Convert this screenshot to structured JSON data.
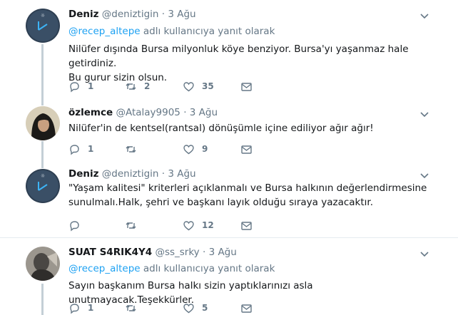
{
  "tweets": [
    {
      "name": "Deniz",
      "handle": "@deniztigin",
      "time": "3 Ağu",
      "reply_mention": "@recep_altepe",
      "reply_suffix": "adlı kullanıcıya yanıt olarak",
      "lines": [
        "Nilüfer dışında Bursa milyonluk köye benziyor. Bursa'yı yaşanmaz hale getirdiniz.",
        "Bu gurur sizin olsun."
      ],
      "replies": "1",
      "retweets": "2",
      "likes": "35"
    },
    {
      "name": "özlemce",
      "handle": "@Atalay9905",
      "time": "3 Ağu",
      "lines": [
        "Nilüfer'in de kentsel(rantsal) dönüşümle içine ediliyor ağır ağır!"
      ],
      "replies": "1",
      "retweets": "",
      "likes": "9"
    },
    {
      "name": "Deniz",
      "handle": "@deniztigin",
      "time": "3 Ağu",
      "lines": [
        "\"Yaşam kalitesi\" kriterleri açıklanmalı ve Bursa halkının değerlendirmesine",
        "sunulmalı.Halk, şehri ve başkanı layık olduğu sıraya yazacaktır."
      ],
      "replies": "",
      "retweets": "",
      "likes": "12"
    },
    {
      "name": "SUAT S4RIK4Y4",
      "handle": "@ss_srky",
      "time": "3 Ağu",
      "reply_mention": "@recep_altepe",
      "reply_suffix": "adlı kullanıcıya yanıt olarak",
      "lines": [
        "Sayın başkanım Bursa halkı sizin yaptıklarınızı asla unutmayacak.Teşekkürler."
      ],
      "replies": "1",
      "retweets": "",
      "likes": "5"
    }
  ],
  "separator": "·",
  "colors": {
    "link": "#1da1f2",
    "muted": "#657786",
    "thread": "#c4cfd6",
    "divider": "#e6ecf0"
  },
  "icons": [
    "reply-icon",
    "retweet-icon",
    "like-icon",
    "message-icon",
    "caret-down-icon"
  ]
}
